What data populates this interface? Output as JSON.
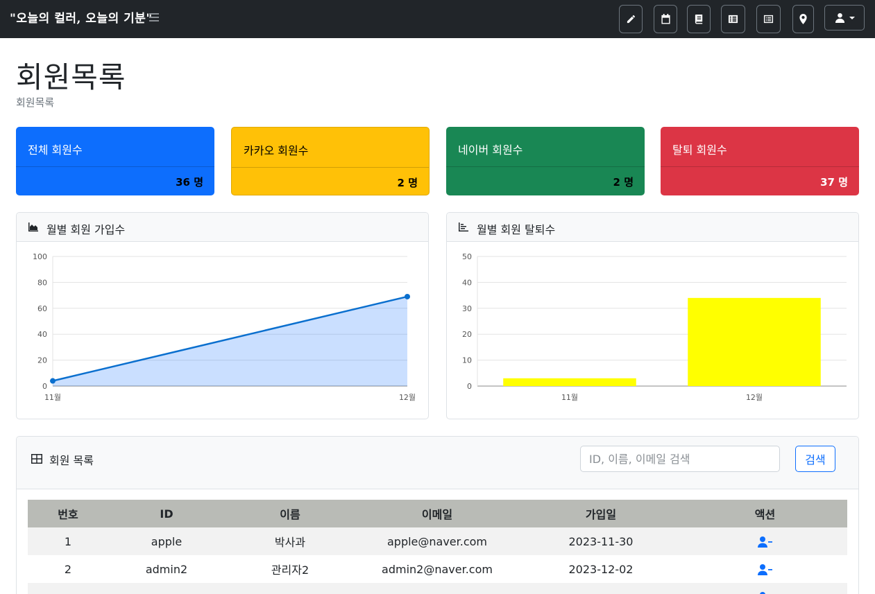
{
  "navbar": {
    "brand": "\"오늘의 컬러, 오늘의 기분\"",
    "icons": [
      "edit-icon",
      "calendar-icon",
      "book-icon",
      "list-icon",
      "list-alt-icon",
      "map-marker-icon",
      "user-icon"
    ]
  },
  "page": {
    "title": "회원목록",
    "breadcrumb": "회원목록"
  },
  "stats": [
    {
      "label": "전체 회원수",
      "value": "36 명",
      "color": "#0d6efd"
    },
    {
      "label": "카카오 회원수",
      "value": "2 명",
      "color": "#ffc107"
    },
    {
      "label": "네이버 회원수",
      "value": "2 명",
      "color": "#198754"
    },
    {
      "label": "탈퇴 회원수",
      "value": "37 명",
      "color": "#dc3545"
    }
  ],
  "signup_card": {
    "title": "월별 회원 가입수"
  },
  "withdraw_card": {
    "title": "월별 회원 탈퇴수"
  },
  "chart_data": [
    {
      "type": "area",
      "title": "월별 회원 가입수",
      "categories": [
        "11월",
        "12월"
      ],
      "series": [
        {
          "values": [
            4,
            69
          ],
          "color": "#0d6efd"
        }
      ],
      "ylim": [
        0,
        100
      ],
      "yticks": [
        0,
        20,
        40,
        60,
        80,
        100
      ],
      "grid": true
    },
    {
      "type": "bar",
      "title": "월별 회원 탈퇴수",
      "categories": [
        "11월",
        "12월"
      ],
      "series": [
        {
          "values": [
            3,
            34
          ],
          "color": "#ffff00"
        }
      ],
      "ylim": [
        0,
        50
      ],
      "yticks": [
        0,
        10,
        20,
        30,
        40,
        50
      ],
      "grid": true
    }
  ],
  "members": {
    "title": "회원 목록",
    "search_placeholder": "ID, 이름, 이메일 검색",
    "search_button": "검색",
    "columns": [
      "번호",
      "ID",
      "이름",
      "이메일",
      "가입일",
      "액션"
    ],
    "rows": [
      {
        "no": "1",
        "id": "apple",
        "name": "박사과",
        "email": "apple@naver.com",
        "date": "2023-11-30",
        "action_icon": "user-minus-icon"
      },
      {
        "no": "2",
        "id": "admin2",
        "name": "관리자2",
        "email": "admin2@naver.com",
        "date": "2023-12-02",
        "action_icon": "user-minus-icon"
      }
    ]
  }
}
